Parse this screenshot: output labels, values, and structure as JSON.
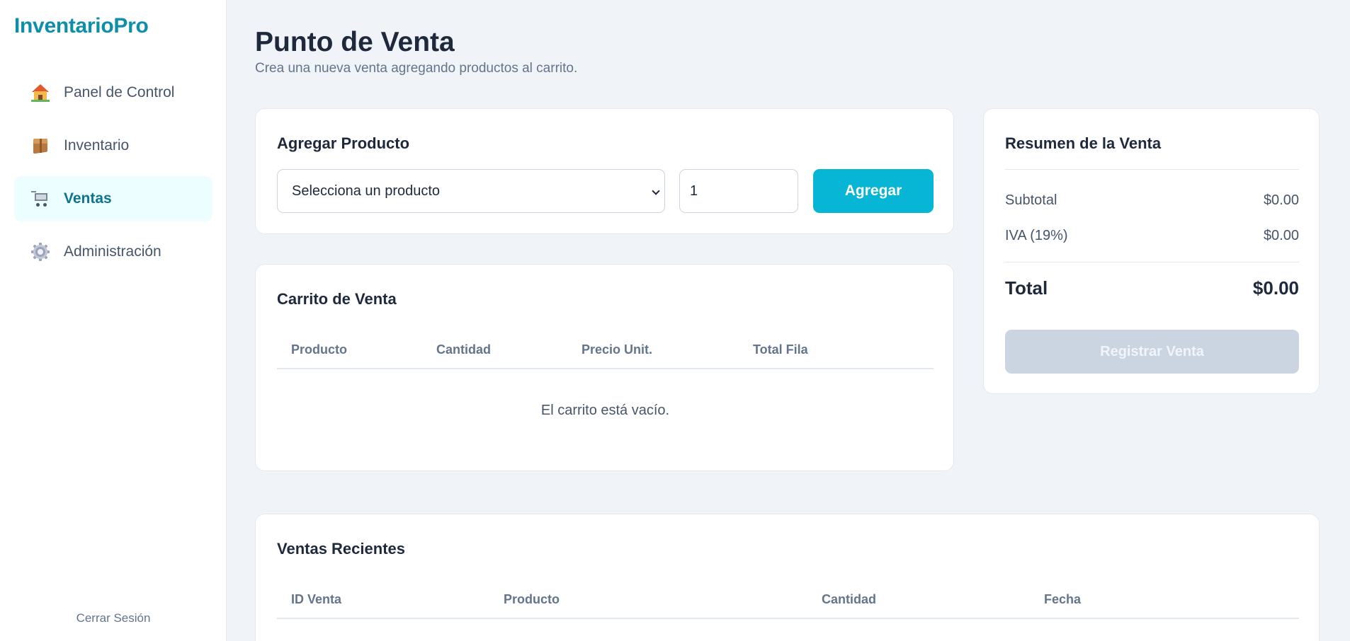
{
  "app": {
    "logo": "InventarioPro"
  },
  "sidebar": {
    "items": [
      {
        "label": "Panel de Control",
        "icon": "house-icon",
        "active": false
      },
      {
        "label": "Inventario",
        "icon": "package-icon",
        "active": false
      },
      {
        "label": "Ventas",
        "icon": "cart-icon",
        "active": true
      },
      {
        "label": "Administración",
        "icon": "gear-icon",
        "active": false
      }
    ],
    "logout": "Cerrar Sesión"
  },
  "header": {
    "title": "Punto de Venta",
    "subtitle": "Crea una nueva venta agregando productos al carrito."
  },
  "add_product": {
    "title": "Agregar Producto",
    "select_placeholder": "Selecciona un producto",
    "quantity": "1",
    "add_button": "Agregar"
  },
  "cart": {
    "title": "Carrito de Venta",
    "columns": [
      "Producto",
      "Cantidad",
      "Precio Unit.",
      "Total Fila"
    ],
    "empty_message": "El carrito está vacío."
  },
  "summary": {
    "title": "Resumen de la Venta",
    "subtotal_label": "Subtotal",
    "subtotal_value": "$0.00",
    "tax_label": "IVA (19%)",
    "tax_value": "$0.00",
    "total_label": "Total",
    "total_value": "$0.00",
    "register_button": "Registrar Venta"
  },
  "recent_sales": {
    "title": "Ventas Recientes",
    "columns": [
      "ID Venta",
      "Producto",
      "Cantidad",
      "Fecha"
    ]
  },
  "colors": {
    "brand": "#0e8fa8",
    "accent": "#06b6d4",
    "active_nav_bg": "#ecfeff",
    "disabled_button": "#cbd5e1",
    "page_bg": "#f0f4f8"
  }
}
